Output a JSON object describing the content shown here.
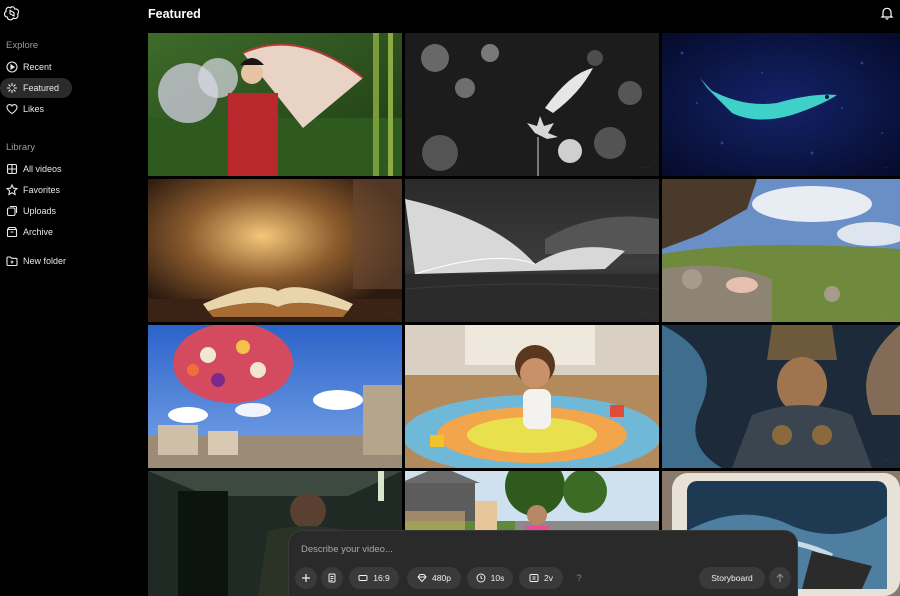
{
  "header": {
    "title": "Featured"
  },
  "sidebar": {
    "explore_label": "Explore",
    "library_label": "Library",
    "explore_items": [
      {
        "label": "Recent",
        "icon": "play-circle-icon"
      },
      {
        "label": "Featured",
        "icon": "sparkle-icon",
        "active": true
      },
      {
        "label": "Likes",
        "icon": "heart-icon"
      }
    ],
    "library_items": [
      {
        "label": "All videos",
        "icon": "grid-icon"
      },
      {
        "label": "Favorites",
        "icon": "star-icon"
      },
      {
        "label": "Uploads",
        "icon": "upload-icon"
      },
      {
        "label": "Archive",
        "icon": "archive-icon"
      }
    ],
    "new_folder": {
      "label": "New folder",
      "icon": "folder-plus-icon"
    }
  },
  "prompt": {
    "placeholder": "Describe your video...",
    "aspect": "16:9",
    "resolution": "480p",
    "duration": "10s",
    "variations": "2v",
    "help": "?",
    "storyboard": "Storyboard"
  },
  "colors": {
    "background": "#000000",
    "panel": "#2a2a2a",
    "chip": "#3a3a3a",
    "active_nav": "#2b2b2b"
  },
  "tiles": [
    {
      "subject": "woman in red kimono with parasol in garden"
    },
    {
      "subject": "black and white butterfly on flower"
    },
    {
      "subject": "glowing blue fish in particle sea"
    },
    {
      "subject": "open book with glowing light rising"
    },
    {
      "subject": "white curved architectural structure in desert"
    },
    {
      "subject": "pig walking on rocky grassland cliff"
    },
    {
      "subject": "floating flower bouquet over city street"
    },
    {
      "subject": "toddler on colorful play mat"
    },
    {
      "subject": "warrior in ornate armor"
    },
    {
      "subject": "man in dark corridor"
    },
    {
      "subject": "girl with pink backpack on suburban street"
    },
    {
      "subject": "retro tv showing ocean waves"
    }
  ]
}
